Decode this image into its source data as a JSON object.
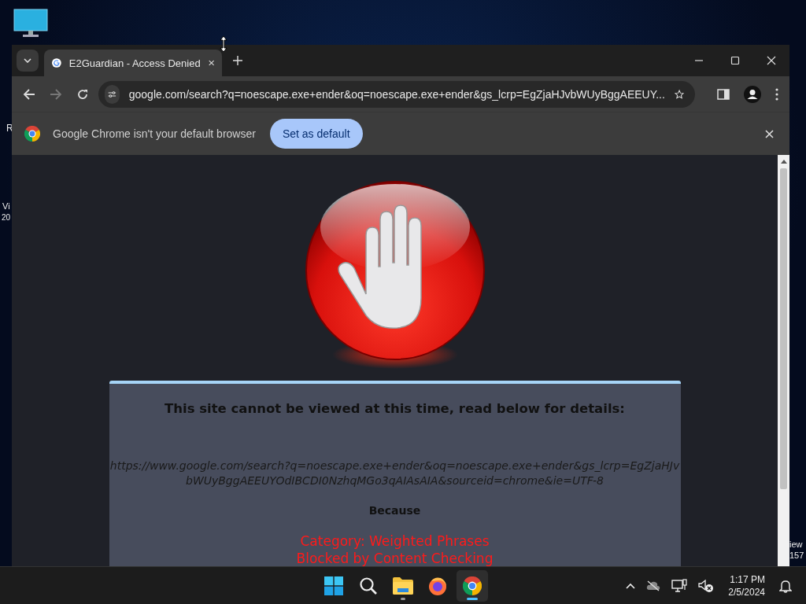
{
  "desktop": {
    "left_labels": [
      "R",
      "Vi",
      "20"
    ],
    "right_labels": [
      "iew",
      "157"
    ]
  },
  "browser": {
    "tabs": [
      {
        "title": "E2Guardian - Access Denied",
        "selected": true
      }
    ],
    "address": "google.com/search?q=noescape.exe+ender&oq=noescape.exe+ender&gs_lcrp=EgZjaHJvbWUyBggAEEUY...",
    "forward_disabled": true,
    "infobar": {
      "message": "Google Chrome isn't your default browser",
      "button": "Set as default"
    }
  },
  "page": {
    "heading": "This site cannot be viewed at this time, read below for details:",
    "url": "https://www.google.com/search?q=noescape.exe+ender&oq=noescape.exe+ender&gs_lcrp=EgZjaHJvbWUyBggAEEUYOdIBCDI0NzhqMGo3qAIAsAIA&sourceid=chrome&ie=UTF-8",
    "because": "Because",
    "reasons": [
      "Category: Weighted Phrases",
      "Blocked by Content Checking"
    ]
  },
  "taskbar": {
    "apps": [
      {
        "kind": "start",
        "running": false,
        "selected": false
      },
      {
        "kind": "search",
        "running": false,
        "selected": false
      },
      {
        "kind": "folder",
        "running": true,
        "selected": false
      },
      {
        "kind": "firefox",
        "running": false,
        "selected": false
      },
      {
        "kind": "chrome",
        "running": true,
        "selected": true
      }
    ],
    "time": "1:17 PM",
    "date": "2/5/2024"
  }
}
